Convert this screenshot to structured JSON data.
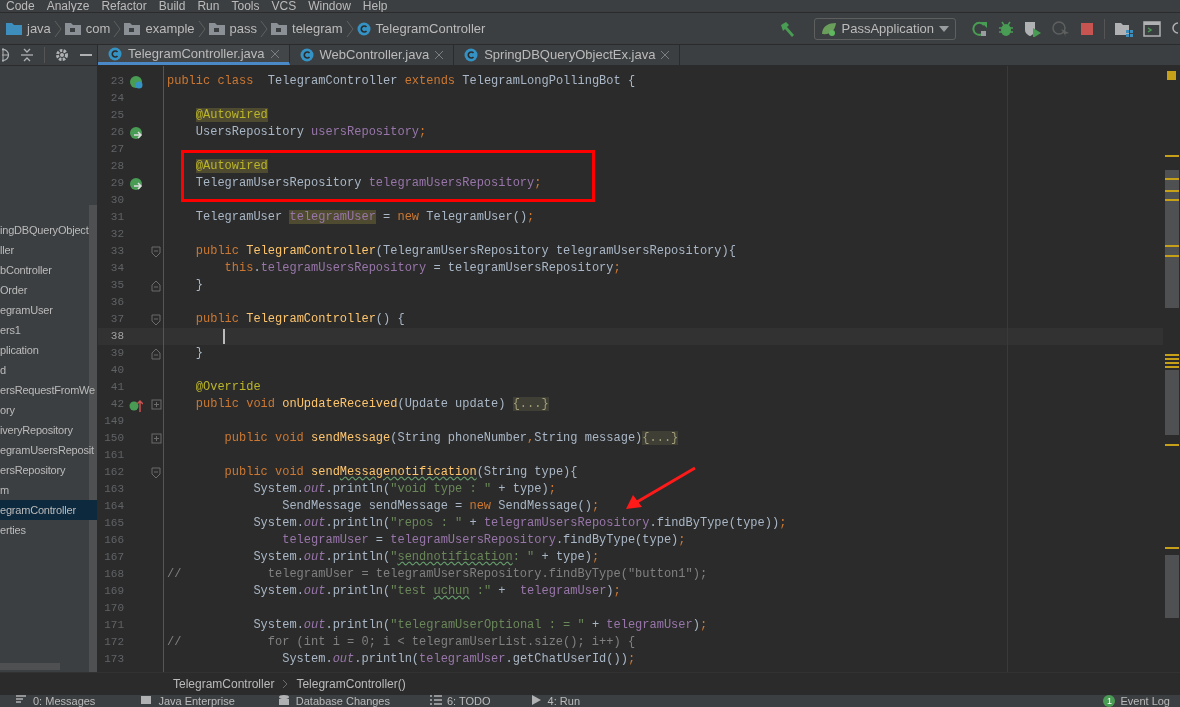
{
  "menu_bar": [
    "Code",
    "Analyze",
    "Refactor",
    "Build",
    "Run",
    "Tools",
    "VCS",
    "Window",
    "Help"
  ],
  "nav_bar": {
    "breadcrumbs": [
      {
        "label": "java",
        "kind": "source-folder"
      },
      {
        "label": "com",
        "kind": "package"
      },
      {
        "label": "example",
        "kind": "package"
      },
      {
        "label": "pass",
        "kind": "package"
      },
      {
        "label": "telegram",
        "kind": "package"
      },
      {
        "label": "TelegramController",
        "kind": "class"
      }
    ]
  },
  "toolbar": {
    "run_configuration": "PassApplication"
  },
  "project_tree": {
    "items": [
      {
        "label": "ingDBQueryObject",
        "selected": false
      },
      {
        "label": "ller",
        "selected": false
      },
      {
        "label": "bController",
        "selected": false
      },
      {
        "label": "Order",
        "selected": false
      },
      {
        "label": "egramUser",
        "selected": false
      },
      {
        "label": "ers1",
        "selected": false
      },
      {
        "label": "plication",
        "selected": false
      },
      {
        "label": "d",
        "selected": false
      },
      {
        "label": "ersRequestFromWe",
        "selected": false
      },
      {
        "label": "ory",
        "selected": false
      },
      {
        "label": "iveryRepository",
        "selected": false
      },
      {
        "label": "egramUsersReposit",
        "selected": false
      },
      {
        "label": "ersRepository",
        "selected": false
      },
      {
        "label": "m",
        "selected": false
      },
      {
        "label": "egramController",
        "selected": true
      },
      {
        "label": "erties",
        "selected": false
      }
    ]
  },
  "editor": {
    "tabs": [
      {
        "label": "TelegramController.java",
        "selected": true
      },
      {
        "label": "WebController.java",
        "selected": false
      },
      {
        "label": "SpringDBQueryObjectEx.java",
        "selected": false
      }
    ],
    "lines": [
      {
        "number": "23",
        "current": false,
        "gutter_icon": {
          "kind": "class"
        },
        "tokens": [
          {
            "text": "public class",
            "kind": "keyword"
          },
          {
            "text": "  TelegramController ",
            "kind": "plain"
          },
          {
            "text": "extends",
            "kind": "keyword"
          },
          {
            "text": " TelegramLongPollingBot {",
            "kind": "plain"
          }
        ]
      },
      {
        "number": "24",
        "current": false
      },
      {
        "number": "25",
        "current": false,
        "tokens": [
          {
            "text": "    @Autowired",
            "kind": "annotation",
            "highlighted": true
          }
        ]
      },
      {
        "number": "26",
        "current": false,
        "gutter_icon": {
          "kind": "bean"
        },
        "tokens": [
          {
            "text": "    UsersRepository ",
            "kind": "plain"
          },
          {
            "text": "usersRepository",
            "kind": "field"
          },
          {
            "text": ";",
            "kind": "keyword"
          }
        ]
      },
      {
        "number": "27",
        "current": false
      },
      {
        "number": "28",
        "current": false,
        "tokens": [
          {
            "text": "    @Autowired",
            "kind": "annotation",
            "highlighted": true
          }
        ]
      },
      {
        "number": "29",
        "current": false,
        "gutter_icon": {
          "kind": "bean"
        },
        "tokens": [
          {
            "text": "    TelegramUsersRepository ",
            "kind": "plain"
          },
          {
            "text": "telegramUsersRepository",
            "kind": "field"
          },
          {
            "text": ";",
            "kind": "keyword"
          }
        ]
      },
      {
        "number": "30",
        "current": false
      },
      {
        "number": "31",
        "current": false,
        "tokens": [
          {
            "text": "    TelegramUser ",
            "kind": "plain"
          },
          {
            "text": "telegramUser",
            "kind": "field",
            "highlighted": true
          },
          {
            "text": " = ",
            "kind": "plain"
          },
          {
            "text": "new",
            "kind": "keyword"
          },
          {
            "text": " TelegramUser()",
            "kind": "plain"
          },
          {
            "text": ";",
            "kind": "keyword"
          }
        ]
      },
      {
        "number": "32",
        "current": false
      },
      {
        "number": "33",
        "current": false,
        "fold_marker": {
          "kind": "start"
        },
        "tokens": [
          {
            "text": "    public",
            "kind": "keyword"
          },
          {
            "text": " TelegramController",
            "kind": "method"
          },
          {
            "text": "(TelegramUsersRepository telegramUsersRepository){",
            "kind": "plain"
          }
        ]
      },
      {
        "number": "34",
        "current": false,
        "tokens": [
          {
            "text": "        this",
            "kind": "keyword"
          },
          {
            "text": ".",
            "kind": "plain"
          },
          {
            "text": "telegramUsersRepository",
            "kind": "field"
          },
          {
            "text": " = telegramUsersRepository",
            "kind": "plain"
          },
          {
            "text": ";",
            "kind": "keyword"
          }
        ]
      },
      {
        "number": "35",
        "current": false,
        "fold_marker": {
          "kind": "end"
        },
        "tokens": [
          {
            "text": "    }",
            "kind": "plain"
          }
        ]
      },
      {
        "number": "36",
        "current": false
      },
      {
        "number": "37",
        "current": false,
        "fold_marker": {
          "kind": "start"
        },
        "tokens": [
          {
            "text": "    public",
            "kind": "keyword"
          },
          {
            "text": " TelegramController",
            "kind": "method"
          },
          {
            "text": "() {",
            "kind": "plain"
          }
        ]
      },
      {
        "number": "38",
        "current": true
      },
      {
        "number": "39",
        "current": false,
        "fold_marker": {
          "kind": "end"
        },
        "tokens": [
          {
            "text": "    }",
            "kind": "plain"
          }
        ]
      },
      {
        "number": "40",
        "current": false
      },
      {
        "number": "41",
        "current": false,
        "tokens": [
          {
            "text": "    @Override",
            "kind": "annotation"
          }
        ]
      },
      {
        "number": "42",
        "current": false,
        "gutter_icon": {
          "kind": "override"
        },
        "fold_marker": {
          "kind": "collapsed"
        },
        "tokens": [
          {
            "text": "    public void",
            "kind": "keyword"
          },
          {
            "text": " onUpdateReceived",
            "kind": "method"
          },
          {
            "text": "(Update update) ",
            "kind": "plain"
          },
          {
            "text": "{...}",
            "kind": "folded"
          }
        ]
      },
      {
        "number": "149",
        "current": false
      },
      {
        "number": "150",
        "current": false,
        "fold_marker": {
          "kind": "collapsed"
        },
        "tokens": [
          {
            "text": "        public void",
            "kind": "keyword"
          },
          {
            "text": " sendMessage",
            "kind": "method"
          },
          {
            "text": "(String phoneNumber",
            "kind": "plain"
          },
          {
            "text": ",",
            "kind": "keyword"
          },
          {
            "text": "String message)",
            "kind": "plain"
          },
          {
            "text": "{...}",
            "kind": "folded"
          }
        ]
      },
      {
        "number": "161",
        "current": false
      },
      {
        "number": "162",
        "current": false,
        "fold_marker": {
          "kind": "start"
        },
        "tokens": [
          {
            "text": "        public void",
            "kind": "keyword"
          },
          {
            "text": " send",
            "kind": "method"
          },
          {
            "text": "Messagenotification",
            "kind": "method",
            "typo": true
          },
          {
            "text": "(String type){",
            "kind": "plain"
          }
        ]
      },
      {
        "number": "163",
        "current": false,
        "tokens": [
          {
            "text": "            System.",
            "kind": "plain"
          },
          {
            "text": "out",
            "kind": "static"
          },
          {
            "text": ".println(",
            "kind": "plain"
          },
          {
            "text": "\"void type : \"",
            "kind": "string"
          },
          {
            "text": " + type)",
            "kind": "plain"
          },
          {
            "text": ";",
            "kind": "keyword"
          }
        ]
      },
      {
        "number": "164",
        "current": false,
        "tokens": [
          {
            "text": "                SendMessage sendMessage = ",
            "kind": "plain"
          },
          {
            "text": "new",
            "kind": "keyword"
          },
          {
            "text": " SendMessage()",
            "kind": "plain"
          },
          {
            "text": ";",
            "kind": "keyword"
          }
        ]
      },
      {
        "number": "165",
        "current": false,
        "tokens": [
          {
            "text": "            System.",
            "kind": "plain"
          },
          {
            "text": "out",
            "kind": "static"
          },
          {
            "text": ".println(",
            "kind": "plain"
          },
          {
            "text": "\"repos : \"",
            "kind": "string"
          },
          {
            "text": " + ",
            "kind": "plain"
          },
          {
            "text": "telegramUsersRepository",
            "kind": "field"
          },
          {
            "text": ".findByType(type))",
            "kind": "plain"
          },
          {
            "text": ";",
            "kind": "keyword"
          }
        ]
      },
      {
        "number": "166",
        "current": false,
        "tokens": [
          {
            "text": "                telegramUser",
            "kind": "field"
          },
          {
            "text": " = ",
            "kind": "plain"
          },
          {
            "text": "telegramUsersRepository",
            "kind": "field"
          },
          {
            "text": ".findByType(type)",
            "kind": "plain"
          },
          {
            "text": ";",
            "kind": "keyword"
          }
        ]
      },
      {
        "number": "167",
        "current": false,
        "tokens": [
          {
            "text": "            System.",
            "kind": "plain"
          },
          {
            "text": "out",
            "kind": "static"
          },
          {
            "text": ".println(",
            "kind": "plain"
          },
          {
            "text": "\"",
            "kind": "string"
          },
          {
            "text": "sendnotification",
            "kind": "string",
            "typo": true
          },
          {
            "text": ": \"",
            "kind": "string"
          },
          {
            "text": " + type)",
            "kind": "plain"
          },
          {
            "text": ";",
            "kind": "keyword"
          }
        ]
      },
      {
        "number": "168",
        "current": false,
        "tokens": [
          {
            "text": "//            telegramUser = telegramUsersRepository.findByType(\"button1\");",
            "kind": "comment"
          }
        ]
      },
      {
        "number": "169",
        "current": false,
        "tokens": [
          {
            "text": "            System.",
            "kind": "plain"
          },
          {
            "text": "out",
            "kind": "static"
          },
          {
            "text": ".println(",
            "kind": "plain"
          },
          {
            "text": "\"test ",
            "kind": "string"
          },
          {
            "text": "uchun",
            "kind": "string",
            "typo": true
          },
          {
            "text": " :\"",
            "kind": "string"
          },
          {
            "text": " +  ",
            "kind": "plain"
          },
          {
            "text": "telegramUser",
            "kind": "field"
          },
          {
            "text": ")",
            "kind": "plain"
          },
          {
            "text": ";",
            "kind": "keyword"
          }
        ]
      },
      {
        "number": "170",
        "current": false
      },
      {
        "number": "171",
        "current": false,
        "tokens": [
          {
            "text": "            System.",
            "kind": "plain"
          },
          {
            "text": "out",
            "kind": "static"
          },
          {
            "text": ".println(",
            "kind": "plain"
          },
          {
            "text": "\"telegramUserOptional : = \"",
            "kind": "string"
          },
          {
            "text": " + ",
            "kind": "plain"
          },
          {
            "text": "telegramUser",
            "kind": "field"
          },
          {
            "text": ")",
            "kind": "plain"
          },
          {
            "text": ";",
            "kind": "keyword"
          }
        ]
      },
      {
        "number": "172",
        "current": false,
        "tokens": [
          {
            "text": "//            for (int i = 0; i < telegramUserList.size(); i++) {",
            "kind": "comment"
          }
        ]
      },
      {
        "number": "173",
        "current": false,
        "tokens": [
          {
            "text": "                System.",
            "kind": "plain"
          },
          {
            "text": "out",
            "kind": "static"
          },
          {
            "text": ".println(",
            "kind": "plain"
          },
          {
            "text": "telegramUser",
            "kind": "field"
          },
          {
            "text": ".getChatUserId())",
            "kind": "plain"
          },
          {
            "text": ";",
            "kind": "keyword"
          }
        ]
      }
    ]
  },
  "breadcrumb_bar": [
    "TelegramController",
    "TelegramController()"
  ],
  "tool_window_bar": [
    {
      "label": "0: Messages",
      "kind": "messages"
    },
    {
      "label": "Java Enterprise",
      "kind": "enterprise"
    },
    {
      "label": "Database Changes",
      "kind": "database"
    },
    {
      "label": "6: TODO",
      "kind": "todo"
    },
    {
      "label": "4: Run",
      "kind": "run"
    },
    {
      "label": "Event Log",
      "kind": "event-log",
      "badge": "1"
    }
  ]
}
